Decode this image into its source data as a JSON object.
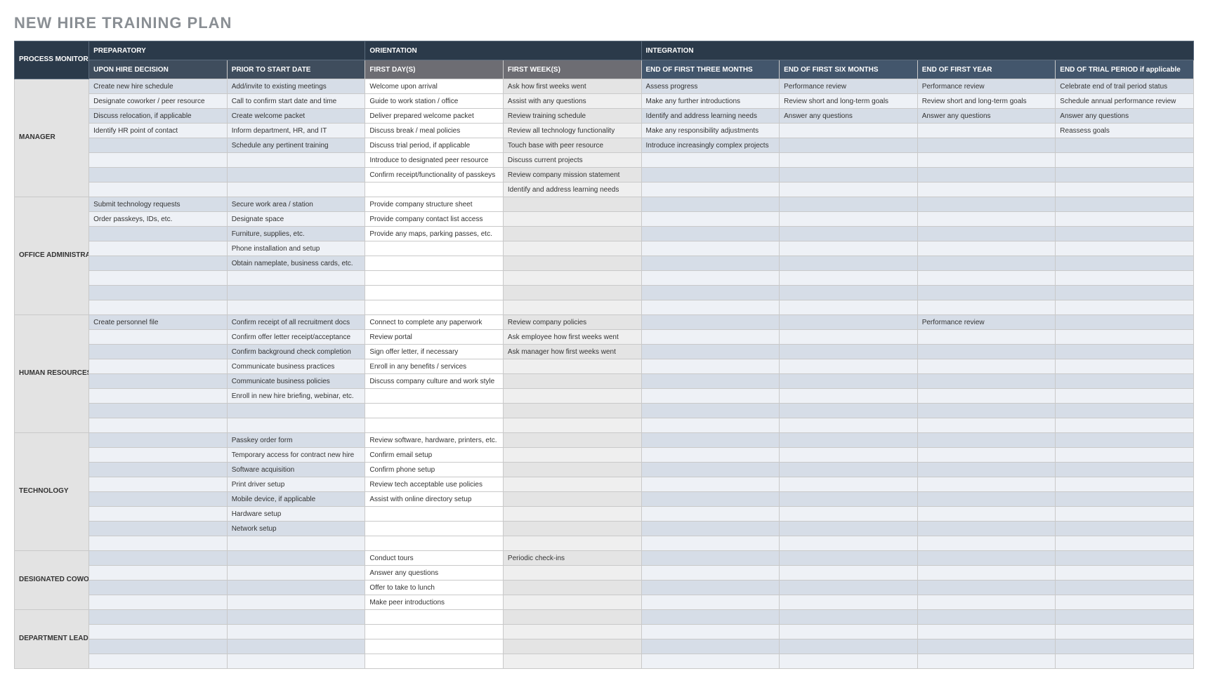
{
  "title": "NEW HIRE TRAINING PLAN",
  "headers": {
    "role": "PROCESS MONITOR / MENTOR",
    "groups": {
      "preparatory": "PREPARATORY",
      "orientation": "ORIENTATION",
      "integration": "INTEGRATION"
    },
    "cols": [
      "UPON HIRE DECISION",
      "PRIOR TO START DATE",
      "FIRST DAY(S)",
      "FIRST WEEK(S)",
      "END OF FIRST THREE MONTHS",
      "END OF FIRST SIX MONTHS",
      "END OF FIRST YEAR",
      "END OF TRIAL PERIOD if applicable"
    ]
  },
  "sections": [
    {
      "role": "MANAGER",
      "rows": [
        [
          "Create new hire schedule",
          "Add/invite to existing meetings",
          "Welcome upon arrival",
          "Ask how first weeks went",
          "Assess progress",
          "Performance review",
          "Performance review",
          "Celebrate end of trail period status"
        ],
        [
          "Designate coworker / peer resource",
          "Call to confirm start date and time",
          "Guide to work station / office",
          "Assist with any questions",
          "Make any further introductions",
          "Review short and long-term goals",
          "Review short and long-term goals",
          "Schedule annual performance review"
        ],
        [
          "Discuss relocation, if applicable",
          "Create welcome packet",
          "Deliver prepared welcome packet",
          "Review training schedule",
          "Identify and address learning needs",
          "Answer any questions",
          "Answer any questions",
          "Answer any questions"
        ],
        [
          "Identify HR point of contact",
          "Inform department, HR, and IT",
          "Discuss break / meal policies",
          "Review all technology functionality",
          "Make any responsibility adjustments",
          "",
          "",
          "Reassess goals"
        ],
        [
          "",
          "Schedule any pertinent training",
          "Discuss trial period, if applicable",
          "Touch base with peer resource",
          "Introduce increasingly complex projects",
          "",
          "",
          ""
        ],
        [
          "",
          "",
          "Introduce to designated peer resource",
          "Discuss current projects",
          "",
          "",
          "",
          ""
        ],
        [
          "",
          "",
          "Confirm receipt/functionality of passkeys",
          "Review company mission statement",
          "",
          "",
          "",
          ""
        ],
        [
          "",
          "",
          "",
          "Identify and address learning needs",
          "",
          "",
          "",
          ""
        ]
      ]
    },
    {
      "role": "OFFICE ADMINISTRATOR",
      "rows": [
        [
          "Submit technology requests",
          "Secure work area / station",
          "Provide company structure sheet",
          "",
          "",
          "",
          "",
          ""
        ],
        [
          "Order passkeys, IDs, etc.",
          "Designate space",
          "Provide company contact list access",
          "",
          "",
          "",
          "",
          ""
        ],
        [
          "",
          "Furniture, supplies, etc.",
          "Provide any maps, parking passes, etc.",
          "",
          "",
          "",
          "",
          ""
        ],
        [
          "",
          "Phone installation and setup",
          "",
          "",
          "",
          "",
          "",
          ""
        ],
        [
          "",
          "Obtain nameplate, business cards, etc.",
          "",
          "",
          "",
          "",
          "",
          ""
        ],
        [
          "",
          "",
          "",
          "",
          "",
          "",
          "",
          ""
        ],
        [
          "",
          "",
          "",
          "",
          "",
          "",
          "",
          ""
        ],
        [
          "",
          "",
          "",
          "",
          "",
          "",
          "",
          ""
        ]
      ]
    },
    {
      "role": "HUMAN RESOURCES",
      "rows": [
        [
          "Create personnel file",
          "Confirm receipt of all recruitment docs",
          "Connect to complete any paperwork",
          "Review company policies",
          "",
          "",
          "Performance review",
          ""
        ],
        [
          "",
          "Confirm offer letter receipt/acceptance",
          "Review portal",
          "Ask employee how first weeks went",
          "",
          "",
          "",
          ""
        ],
        [
          "",
          "Confirm background check completion",
          "Sign offer letter, if necessary",
          "Ask manager how first weeks went",
          "",
          "",
          "",
          ""
        ],
        [
          "",
          "Communicate business practices",
          "Enroll in any benefits / services",
          "",
          "",
          "",
          "",
          ""
        ],
        [
          "",
          "Communicate business policies",
          "Discuss company culture and work style",
          "",
          "",
          "",
          "",
          ""
        ],
        [
          "",
          "Enroll in new hire briefing, webinar, etc.",
          "",
          "",
          "",
          "",
          "",
          ""
        ],
        [
          "",
          "",
          "",
          "",
          "",
          "",
          "",
          ""
        ],
        [
          "",
          "",
          "",
          "",
          "",
          "",
          "",
          ""
        ]
      ]
    },
    {
      "role": "TECHNOLOGY",
      "rows": [
        [
          "",
          "Passkey order form",
          "Review software, hardware, printers, etc.",
          "",
          "",
          "",
          "",
          ""
        ],
        [
          "",
          "Temporary access for contract new hire",
          "Confirm email setup",
          "",
          "",
          "",
          "",
          ""
        ],
        [
          "",
          "Software acquisition",
          "Confirm phone setup",
          "",
          "",
          "",
          "",
          ""
        ],
        [
          "",
          "Print driver setup",
          "Review tech acceptable use policies",
          "",
          "",
          "",
          "",
          ""
        ],
        [
          "",
          "Mobile device, if applicable",
          "Assist with online directory setup",
          "",
          "",
          "",
          "",
          ""
        ],
        [
          "",
          "Hardware setup",
          "",
          "",
          "",
          "",
          "",
          ""
        ],
        [
          "",
          "Network setup",
          "",
          "",
          "",
          "",
          "",
          ""
        ],
        [
          "",
          "",
          "",
          "",
          "",
          "",
          "",
          ""
        ]
      ]
    },
    {
      "role": "DESIGNATED COWORKER / PEER RESOURCE",
      "rows": [
        [
          "",
          "",
          "Conduct tours",
          "Periodic check-ins",
          "",
          "",
          "",
          ""
        ],
        [
          "",
          "",
          "Answer any questions",
          "",
          "",
          "",
          "",
          ""
        ],
        [
          "",
          "",
          "Offer to take to lunch",
          "",
          "",
          "",
          "",
          ""
        ],
        [
          "",
          "",
          "Make peer introductions",
          "",
          "",
          "",
          "",
          ""
        ]
      ]
    },
    {
      "role": "DEPARTMENT LEAD if applicable",
      "rows": [
        [
          "",
          "",
          "",
          "",
          "",
          "",
          "",
          ""
        ],
        [
          "",
          "",
          "",
          "",
          "",
          "",
          "",
          ""
        ],
        [
          "",
          "",
          "",
          "",
          "",
          "",
          "",
          ""
        ],
        [
          "",
          "",
          "",
          "",
          "",
          "",
          "",
          ""
        ]
      ]
    }
  ]
}
